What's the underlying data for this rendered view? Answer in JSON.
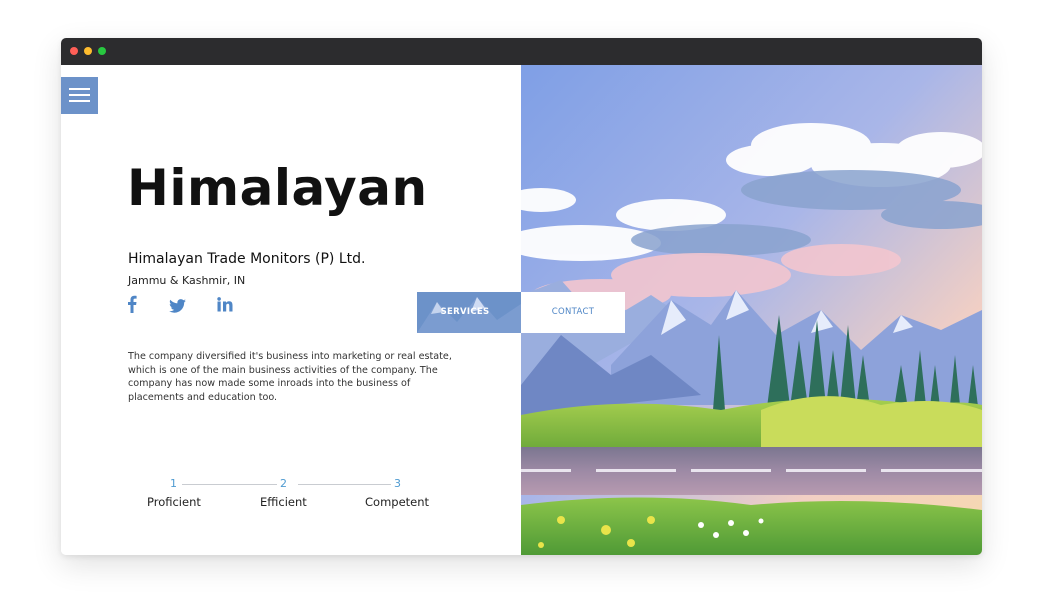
{
  "hero": {
    "title": "Himalayan",
    "company": "Himalayan Trade Monitors (P) Ltd.",
    "location": "Jammu & Kashmir, IN",
    "description": "The company diversified it's business into marketing or real estate, which is one of the main business activities of the company. The company has now made some inroads into the business of placements and education too."
  },
  "social": {
    "facebook": "f",
    "twitter": "twitter-bird",
    "linkedin": "in"
  },
  "steps": [
    {
      "number": "1",
      "label": "Proficient"
    },
    {
      "number": "2",
      "label": "Efficient"
    },
    {
      "number": "3",
      "label": "Competent"
    }
  ],
  "nav": {
    "services_label": "SERVICES",
    "contact_label": "CONTACT"
  },
  "colors": {
    "accent": "#6c92c9",
    "step_accent": "#4f9bd1",
    "titlebar": "#2c2c2e"
  },
  "icons": [
    "menu-icon",
    "facebook-icon",
    "twitter-icon",
    "linkedin-icon"
  ]
}
